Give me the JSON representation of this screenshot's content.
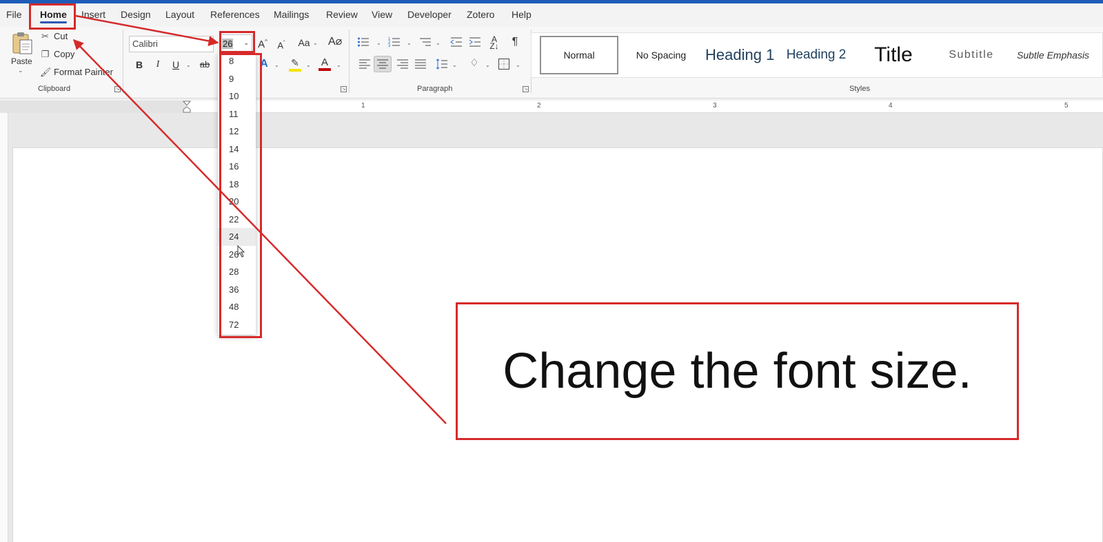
{
  "menu": {
    "tabs": [
      {
        "label": "File",
        "active": false
      },
      {
        "label": "Home",
        "active": true
      },
      {
        "label": "Insert",
        "active": false
      },
      {
        "label": "Design",
        "active": false
      },
      {
        "label": "Layout",
        "active": false
      },
      {
        "label": "References",
        "active": false
      },
      {
        "label": "Mailings",
        "active": false
      },
      {
        "label": "Review",
        "active": false
      },
      {
        "label": "View",
        "active": false
      },
      {
        "label": "Developer",
        "active": false
      },
      {
        "label": "Zotero",
        "active": false
      },
      {
        "label": "Help",
        "active": false
      }
    ]
  },
  "clipboard": {
    "paste_label": "Paste",
    "cut_label": "Cut",
    "copy_label": "Copy",
    "format_painter_label": "Format Painter",
    "group_label": "Clipboard"
  },
  "font": {
    "name": "Calibri",
    "size": "26",
    "bold": "B",
    "italic": "I",
    "underline": "U",
    "strike": "ab",
    "change_case": "Aa",
    "grow": "A",
    "shrink": "A",
    "text_effects": "A",
    "font_color": "A"
  },
  "paragraph": {
    "group_label": "Paragraph"
  },
  "styles": {
    "group_label": "Styles",
    "items": [
      {
        "label": "Normal"
      },
      {
        "label": "No Spacing"
      },
      {
        "label": "Heading 1"
      },
      {
        "label": "Heading 2"
      },
      {
        "label": "Title"
      },
      {
        "label": "Subtitle"
      },
      {
        "label": "Subtle Emphasis"
      }
    ]
  },
  "ruler": {
    "numbers": [
      "1",
      "2",
      "3",
      "4",
      "5"
    ]
  },
  "size_dropdown": {
    "options": [
      "8",
      "9",
      "10",
      "11",
      "12",
      "14",
      "16",
      "18",
      "20",
      "22",
      "24",
      "26",
      "28",
      "36",
      "48",
      "72"
    ],
    "hover": "24"
  },
  "annotation": {
    "callout_text": "Change the font size."
  },
  "colors": {
    "accent": "#1e5bb8",
    "annotation_red": "#d62a2a",
    "highlight_yellow": "#f5e400",
    "font_color_red": "#c00000"
  }
}
